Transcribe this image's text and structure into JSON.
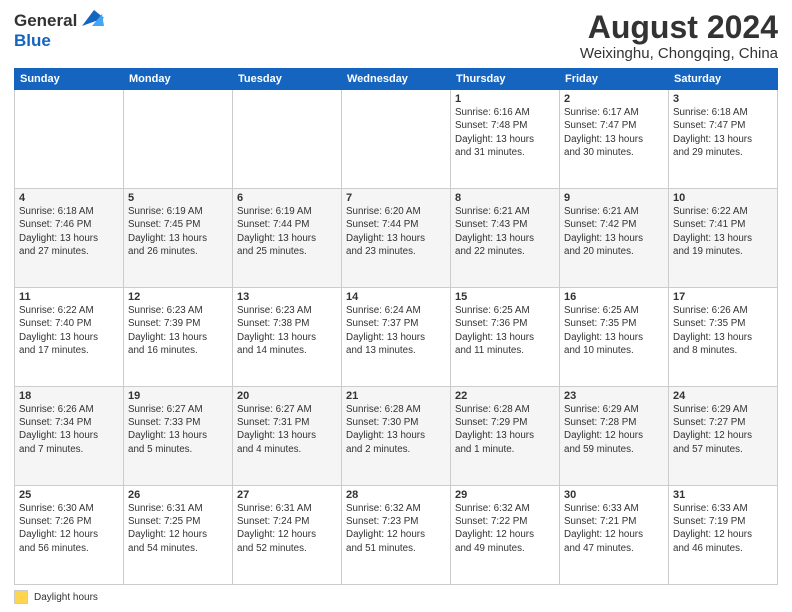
{
  "header": {
    "logo_line1": "General",
    "logo_line2": "Blue",
    "main_title": "August 2024",
    "subtitle": "Weixinghu, Chongqing, China"
  },
  "days_of_week": [
    "Sunday",
    "Monday",
    "Tuesday",
    "Wednesday",
    "Thursday",
    "Friday",
    "Saturday"
  ],
  "weeks": [
    [
      {
        "day": "",
        "info": ""
      },
      {
        "day": "",
        "info": ""
      },
      {
        "day": "",
        "info": ""
      },
      {
        "day": "",
        "info": ""
      },
      {
        "day": "1",
        "info": "Sunrise: 6:16 AM\nSunset: 7:48 PM\nDaylight: 13 hours\nand 31 minutes."
      },
      {
        "day": "2",
        "info": "Sunrise: 6:17 AM\nSunset: 7:47 PM\nDaylight: 13 hours\nand 30 minutes."
      },
      {
        "day": "3",
        "info": "Sunrise: 6:18 AM\nSunset: 7:47 PM\nDaylight: 13 hours\nand 29 minutes."
      }
    ],
    [
      {
        "day": "4",
        "info": "Sunrise: 6:18 AM\nSunset: 7:46 PM\nDaylight: 13 hours\nand 27 minutes."
      },
      {
        "day": "5",
        "info": "Sunrise: 6:19 AM\nSunset: 7:45 PM\nDaylight: 13 hours\nand 26 minutes."
      },
      {
        "day": "6",
        "info": "Sunrise: 6:19 AM\nSunset: 7:44 PM\nDaylight: 13 hours\nand 25 minutes."
      },
      {
        "day": "7",
        "info": "Sunrise: 6:20 AM\nSunset: 7:44 PM\nDaylight: 13 hours\nand 23 minutes."
      },
      {
        "day": "8",
        "info": "Sunrise: 6:21 AM\nSunset: 7:43 PM\nDaylight: 13 hours\nand 22 minutes."
      },
      {
        "day": "9",
        "info": "Sunrise: 6:21 AM\nSunset: 7:42 PM\nDaylight: 13 hours\nand 20 minutes."
      },
      {
        "day": "10",
        "info": "Sunrise: 6:22 AM\nSunset: 7:41 PM\nDaylight: 13 hours\nand 19 minutes."
      }
    ],
    [
      {
        "day": "11",
        "info": "Sunrise: 6:22 AM\nSunset: 7:40 PM\nDaylight: 13 hours\nand 17 minutes."
      },
      {
        "day": "12",
        "info": "Sunrise: 6:23 AM\nSunset: 7:39 PM\nDaylight: 13 hours\nand 16 minutes."
      },
      {
        "day": "13",
        "info": "Sunrise: 6:23 AM\nSunset: 7:38 PM\nDaylight: 13 hours\nand 14 minutes."
      },
      {
        "day": "14",
        "info": "Sunrise: 6:24 AM\nSunset: 7:37 PM\nDaylight: 13 hours\nand 13 minutes."
      },
      {
        "day": "15",
        "info": "Sunrise: 6:25 AM\nSunset: 7:36 PM\nDaylight: 13 hours\nand 11 minutes."
      },
      {
        "day": "16",
        "info": "Sunrise: 6:25 AM\nSunset: 7:35 PM\nDaylight: 13 hours\nand 10 minutes."
      },
      {
        "day": "17",
        "info": "Sunrise: 6:26 AM\nSunset: 7:35 PM\nDaylight: 13 hours\nand 8 minutes."
      }
    ],
    [
      {
        "day": "18",
        "info": "Sunrise: 6:26 AM\nSunset: 7:34 PM\nDaylight: 13 hours\nand 7 minutes."
      },
      {
        "day": "19",
        "info": "Sunrise: 6:27 AM\nSunset: 7:33 PM\nDaylight: 13 hours\nand 5 minutes."
      },
      {
        "day": "20",
        "info": "Sunrise: 6:27 AM\nSunset: 7:31 PM\nDaylight: 13 hours\nand 4 minutes."
      },
      {
        "day": "21",
        "info": "Sunrise: 6:28 AM\nSunset: 7:30 PM\nDaylight: 13 hours\nand 2 minutes."
      },
      {
        "day": "22",
        "info": "Sunrise: 6:28 AM\nSunset: 7:29 PM\nDaylight: 13 hours\nand 1 minute."
      },
      {
        "day": "23",
        "info": "Sunrise: 6:29 AM\nSunset: 7:28 PM\nDaylight: 12 hours\nand 59 minutes."
      },
      {
        "day": "24",
        "info": "Sunrise: 6:29 AM\nSunset: 7:27 PM\nDaylight: 12 hours\nand 57 minutes."
      }
    ],
    [
      {
        "day": "25",
        "info": "Sunrise: 6:30 AM\nSunset: 7:26 PM\nDaylight: 12 hours\nand 56 minutes."
      },
      {
        "day": "26",
        "info": "Sunrise: 6:31 AM\nSunset: 7:25 PM\nDaylight: 12 hours\nand 54 minutes."
      },
      {
        "day": "27",
        "info": "Sunrise: 6:31 AM\nSunset: 7:24 PM\nDaylight: 12 hours\nand 52 minutes."
      },
      {
        "day": "28",
        "info": "Sunrise: 6:32 AM\nSunset: 7:23 PM\nDaylight: 12 hours\nand 51 minutes."
      },
      {
        "day": "29",
        "info": "Sunrise: 6:32 AM\nSunset: 7:22 PM\nDaylight: 12 hours\nand 49 minutes."
      },
      {
        "day": "30",
        "info": "Sunrise: 6:33 AM\nSunset: 7:21 PM\nDaylight: 12 hours\nand 47 minutes."
      },
      {
        "day": "31",
        "info": "Sunrise: 6:33 AM\nSunset: 7:19 PM\nDaylight: 12 hours\nand 46 minutes."
      }
    ]
  ],
  "legend": {
    "label": "Daylight hours"
  }
}
